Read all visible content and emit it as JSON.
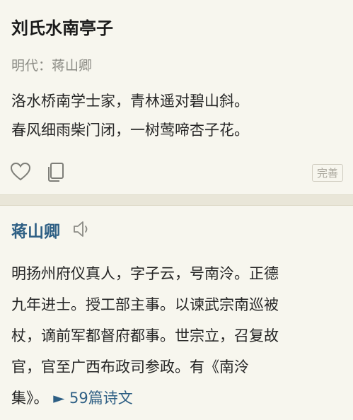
{
  "poem": {
    "title": "刘氏水南亭子",
    "meta": "明代：蒋山卿",
    "lines": [
      "洛水桥南学士家，青林遥对碧山斜。",
      "春风细雨柴门闭，一树莺啼杏子花。"
    ],
    "actions": {
      "like_icon": "heart-icon",
      "copy_icon": "copy-icon",
      "fix_label": "完善"
    }
  },
  "author": {
    "name": "蒋山卿",
    "audio_icon": "speaker-icon",
    "bio_lines": [
      "明扬州府仪真人，字子云，号南泠。正德",
      "九年进士。授工部主事。以谏武宗南巡被",
      "杖，谪前军都督府都事。世宗立，召复故",
      "官，官至广西布政司参政。有《南泠",
      "集》。"
    ],
    "more_link": "► 59篇诗文"
  },
  "colors": {
    "background": "#e9e6d8",
    "card": "#f7f6ee",
    "link": "#2e5f84",
    "muted": "#8b8b84"
  }
}
